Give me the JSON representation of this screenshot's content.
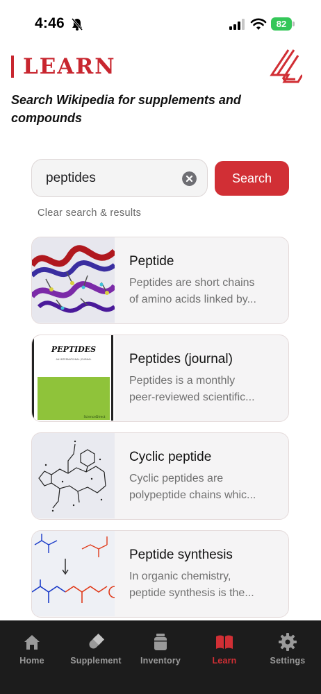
{
  "status_bar": {
    "time": "4:46",
    "battery": "82"
  },
  "header": {
    "title": "LEARN",
    "subtitle_line1": "Search Wikipedia for supplements and",
    "subtitle_line2": "compounds"
  },
  "search": {
    "value": "peptides",
    "button_label": "Search",
    "clear_label": "Clear search & results"
  },
  "results": [
    {
      "title": "Peptide",
      "desc_line1": "Peptides are short chains",
      "desc_line2": "of amino acids linked by..."
    },
    {
      "title": "Peptides (journal)",
      "desc_line1": "Peptides is a monthly",
      "desc_line2": "peer-reviewed scientific...",
      "thumb_text": "PEPTIDES",
      "thumb_subtext": "AN INTERNATIONAL JOURNAL",
      "thumb_publisher": "ScienceDirect"
    },
    {
      "title": "Cyclic peptide",
      "desc_line1": "Cyclic peptides are",
      "desc_line2": "polypeptide chains whic..."
    },
    {
      "title": "Peptide synthesis",
      "desc_line1": "In organic chemistry,",
      "desc_line2": "peptide synthesis is the..."
    }
  ],
  "tabs": [
    {
      "label": "Home",
      "icon": "home-icon"
    },
    {
      "label": "Supplement",
      "icon": "pill-icon"
    },
    {
      "label": "Inventory",
      "icon": "jar-icon"
    },
    {
      "label": "Learn",
      "icon": "book-icon",
      "active": true
    },
    {
      "label": "Settings",
      "icon": "gear-icon"
    }
  ],
  "colors": {
    "accent": "#d12f35",
    "tab_bar": "#1c1c1c",
    "inactive_tab": "#9a9a9a"
  }
}
